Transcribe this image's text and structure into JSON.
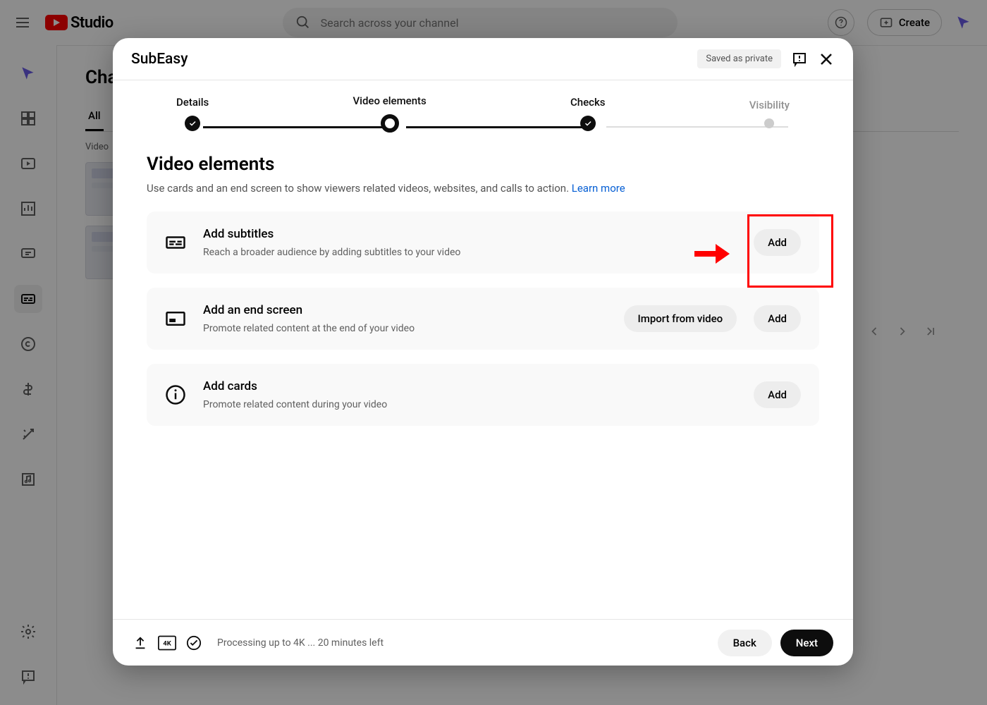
{
  "header": {
    "logo_text": "Studio",
    "search_placeholder": "Search across your channel",
    "create_label": "Create"
  },
  "background": {
    "page_title_partial": "Cha",
    "tab_all": "All",
    "col_video": "Video"
  },
  "modal": {
    "title": "SubEasy",
    "save_status": "Saved as private",
    "steps": {
      "details": "Details",
      "video_elements": "Video elements",
      "checks": "Checks",
      "visibility": "Visibility"
    },
    "section_title": "Video elements",
    "section_desc": "Use cards and an end screen to show viewers related videos, websites, and calls to action. ",
    "learn_more": "Learn more",
    "cards": {
      "subtitles": {
        "title": "Add subtitles",
        "desc": "Reach a broader audience by adding subtitles to your video",
        "action": "Add"
      },
      "endscreen": {
        "title": "Add an end screen",
        "desc": "Promote related content at the end of your video",
        "import": "Import from video",
        "action": "Add"
      },
      "cards": {
        "title": "Add cards",
        "desc": "Promote related content during your video",
        "action": "Add"
      }
    },
    "footer": {
      "status": "Processing up to 4K ... 20 minutes left",
      "back": "Back",
      "next": "Next"
    }
  }
}
